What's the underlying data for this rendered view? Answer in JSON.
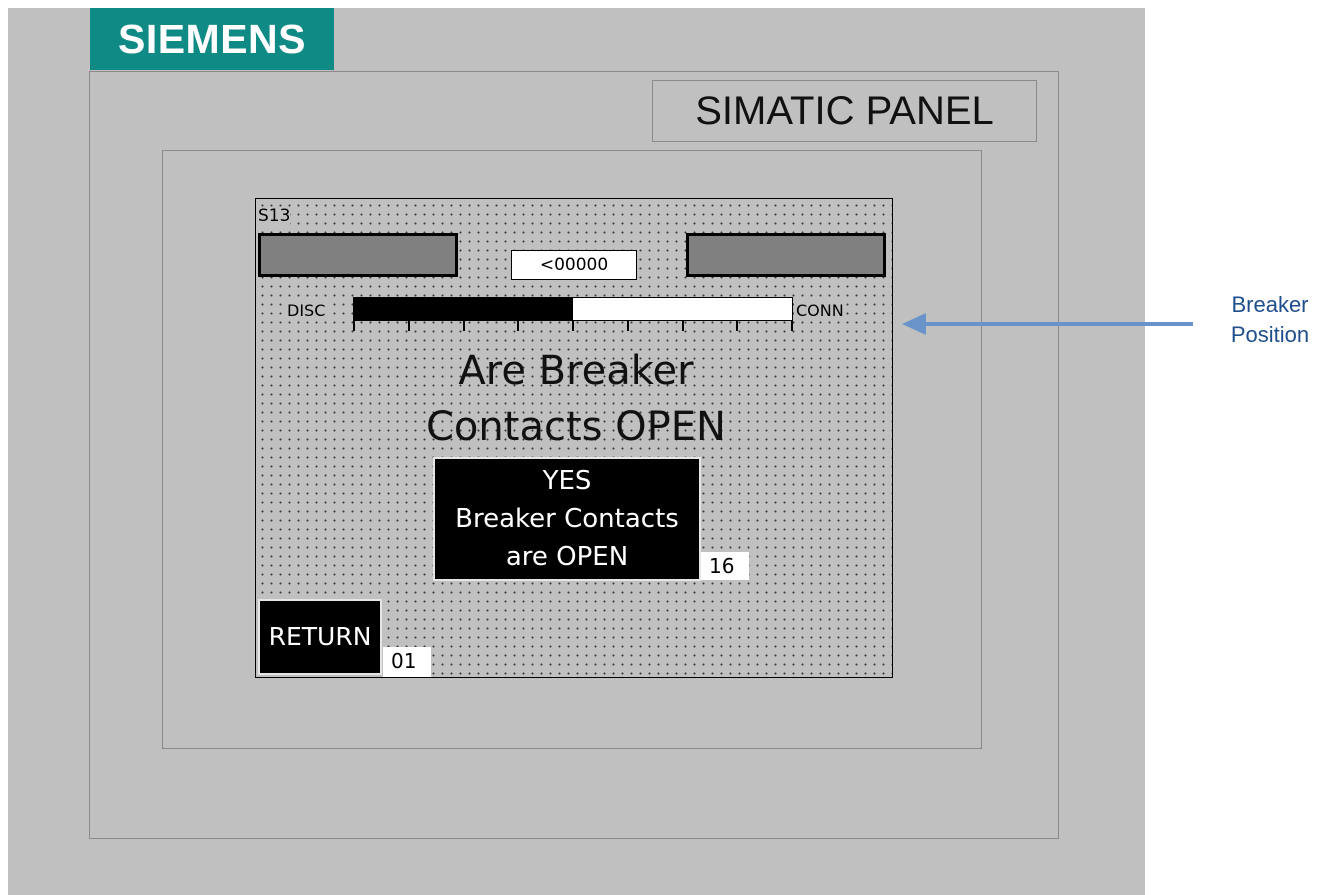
{
  "brand": {
    "logo_text": "SIEMENS",
    "logo_color": "#0f8a84"
  },
  "panel": {
    "label": "SIMATIC PANEL"
  },
  "screen": {
    "id": "S13",
    "value_display": "<00000",
    "position_bar": {
      "left_label": "DISC",
      "right_label": "CONN",
      "fill_fraction": 0.5
    },
    "question": {
      "line1": "Are Breaker",
      "line2": "Contacts OPEN"
    },
    "yes_button": {
      "line1": "YES",
      "line2": "Breaker Contacts",
      "line3": "are OPEN",
      "number": "16"
    },
    "return_button": {
      "label": "RETURN",
      "number": "01"
    }
  },
  "annotation": {
    "line1": "Breaker",
    "line2": "Position",
    "color": "#1f4e8c",
    "icon": "arrow-left-icon"
  }
}
